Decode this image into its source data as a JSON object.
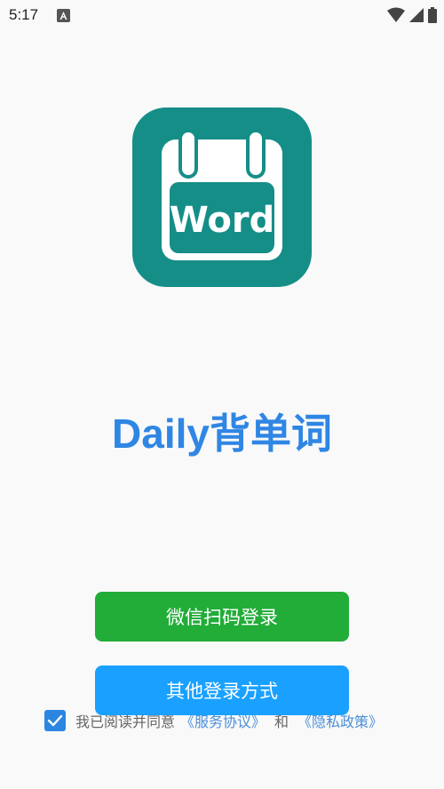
{
  "status_bar": {
    "time": "5:17",
    "icons": [
      "notification-a-icon",
      "wifi-icon",
      "signal-icon",
      "battery-icon"
    ]
  },
  "logo": {
    "text": "Word",
    "bg_color": "#168e88"
  },
  "app": {
    "title": "Daily背单词",
    "title_color": "#2f86e4"
  },
  "buttons": {
    "wechat_label": "微信扫码登录",
    "other_label": "其他登录方式",
    "wechat_color": "#22ac38",
    "other_color": "#1aa1ff"
  },
  "agreement": {
    "checked": true,
    "prefix": "我已阅读并同意",
    "service_link": "《服务协议》",
    "and": "和",
    "privacy_link": "《隐私政策》"
  }
}
